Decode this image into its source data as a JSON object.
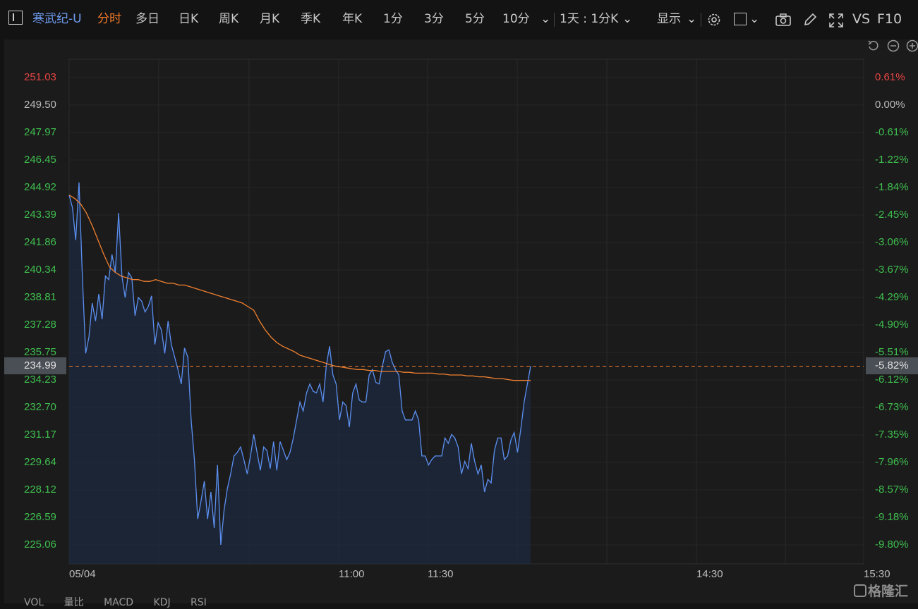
{
  "toolbar": {
    "stock_name": "寒武纪-U",
    "tabs": [
      "分时",
      "多日",
      "日K",
      "周K",
      "月K",
      "季K",
      "年K",
      "1分",
      "3分",
      "5分",
      "10分"
    ],
    "active_tab": "分时",
    "period_select": "1天 : 1分K",
    "display_label": "显示",
    "vs_label": "VS",
    "f10_label": "F10"
  },
  "colors": {
    "price_line": "#5b8ff0",
    "avg_line": "#f08030",
    "up": "#e84444",
    "down": "#3fbf4f",
    "flat": "#b9b9b9"
  },
  "chart_data": {
    "type": "line",
    "x_ticks": [
      "05/04",
      "11:00",
      "11:30",
      "14:30",
      "15:30"
    ],
    "y_left_ticks": [
      "251.03",
      "249.50",
      "247.97",
      "246.45",
      "244.92",
      "243.39",
      "241.86",
      "240.34",
      "238.81",
      "237.28",
      "235.75",
      "234.23",
      "232.70",
      "231.17",
      "229.64",
      "228.12",
      "226.59",
      "225.06"
    ],
    "y_right_ticks": [
      "0.61%",
      "0.00%",
      "-0.61%",
      "-1.22%",
      "-1.84%",
      "-2.45%",
      "-3.06%",
      "-3.67%",
      "-4.29%",
      "-4.90%",
      "-5.51%",
      "-6.12%",
      "-6.73%",
      "-7.35%",
      "-7.96%",
      "-8.57%",
      "-9.18%",
      "-9.80%"
    ],
    "ylim": [
      225.06,
      251.03
    ],
    "prev_close": 249.5,
    "current_price": "234.99",
    "current_pct": "-5.82%",
    "series": [
      {
        "values": [
          244.5,
          243.8,
          242.0,
          245.2,
          240.0,
          235.7,
          236.6,
          238.5,
          237.5,
          239.0,
          237.6,
          240.0,
          239.8,
          241.2,
          240.2,
          243.5,
          240.0,
          238.8,
          240.2,
          239.9,
          237.8,
          238.8,
          238.6,
          238.0,
          238.3,
          238.9,
          236.2,
          237.4,
          237.0,
          235.7,
          237.5,
          236.2,
          235.5,
          234.8,
          234.0,
          236.0,
          235.5,
          232.0,
          229.8,
          226.5,
          227.5,
          228.6,
          226.5,
          228.0,
          226.0,
          229.5,
          225.06,
          227.0,
          228.2,
          229.0,
          230.0,
          230.2,
          230.5,
          229.8,
          229.0,
          230.0,
          231.2,
          230.2,
          229.2,
          230.5,
          230.3,
          229.3,
          230.8,
          229.2,
          230.8,
          230.3,
          229.8,
          230.2,
          231.0,
          232.0,
          233.0,
          232.5,
          233.5,
          234.0,
          233.6,
          233.5,
          234.0,
          233.0,
          235.0,
          236.1,
          234.5,
          234.0,
          232.0,
          233.0,
          232.8,
          231.6,
          233.5,
          234.0,
          233.1,
          233.0,
          233.0,
          234.5,
          234.8,
          234.1,
          234.0,
          235.0,
          235.8,
          235.9,
          235.2,
          234.8,
          234.5,
          232.5,
          232.0,
          232.0,
          232.0,
          232.5,
          232.0,
          230.0,
          230.0,
          229.5,
          229.8,
          230.0,
          230.0,
          230.0,
          231.0,
          230.7,
          231.2,
          231.0,
          230.5,
          229.0,
          229.7,
          229.3,
          230.7,
          229.7,
          229.0,
          229.5,
          228.0,
          228.7,
          228.5,
          230.3,
          231.0,
          231.0,
          229.8,
          230.0,
          230.9,
          231.3,
          230.2,
          231.5,
          233.0,
          234.0,
          235.0
        ]
      },
      {
        "values": [
          244.5,
          244.3,
          244.0,
          243.5,
          242.8,
          242.0,
          241.2,
          240.5,
          240.2,
          240.0,
          239.9,
          239.8,
          239.8,
          239.7,
          239.7,
          239.8,
          239.7,
          239.6,
          239.6,
          239.5,
          239.5,
          239.4,
          239.3,
          239.2,
          239.1,
          239.0,
          238.9,
          238.8,
          238.7,
          238.6,
          238.5,
          238.3,
          238.1,
          237.5,
          237.0,
          236.6,
          236.3,
          236.1,
          235.95,
          235.8,
          235.6,
          235.5,
          235.4,
          235.3,
          235.2,
          235.1,
          235.0,
          234.95,
          234.9,
          234.85,
          234.8,
          234.8,
          234.75,
          234.75,
          234.7,
          234.7,
          234.7,
          234.7,
          234.65,
          234.65,
          234.6,
          234.6,
          234.6,
          234.6,
          234.55,
          234.55,
          234.5,
          234.5,
          234.5,
          234.45,
          234.45,
          234.4,
          234.4,
          234.35,
          234.3,
          234.3,
          234.25,
          234.2,
          234.2,
          234.2,
          234.2
        ]
      }
    ]
  },
  "bottom_tabs": [
    "VOL",
    "量比",
    "MACD",
    "KDJ",
    "RSI"
  ],
  "watermark": "格隆汇"
}
